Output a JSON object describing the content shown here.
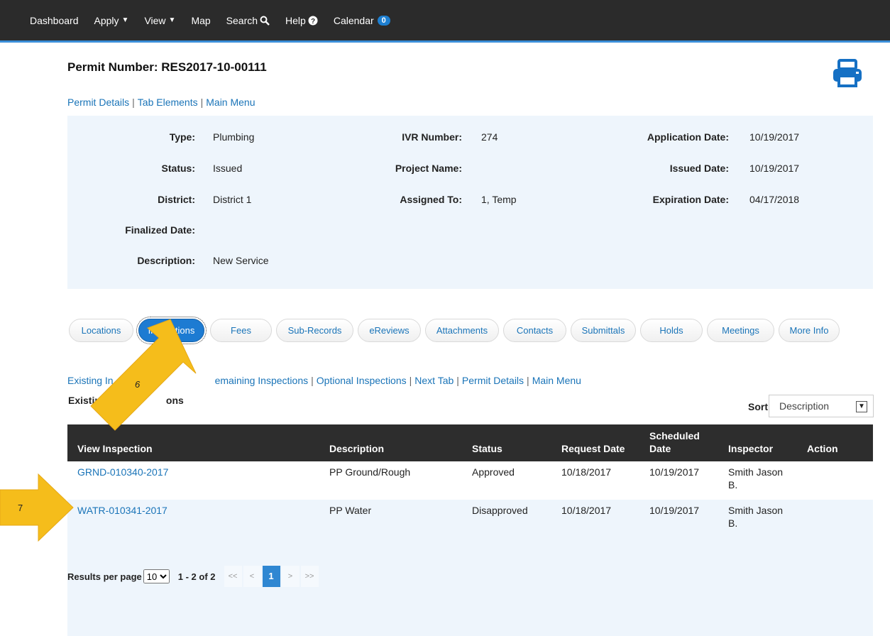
{
  "nav": {
    "dashboard": "Dashboard",
    "apply": "Apply",
    "view": "View",
    "map": "Map",
    "search": "Search",
    "help": "Help",
    "calendar": "Calendar",
    "calendar_count": "0"
  },
  "permit": {
    "title": "Permit Number: RES2017-10-00111"
  },
  "top_links": {
    "permit_details": "Permit Details",
    "tab_elements": "Tab Elements",
    "main_menu": "Main Menu",
    "sep": "|"
  },
  "details": {
    "type_label": "Type:",
    "type_value": "Plumbing",
    "status_label": "Status:",
    "status_value": "Issued",
    "district_label": "District:",
    "district_value": "District 1",
    "finalized_label": "Finalized Date:",
    "finalized_value": "",
    "description_label": "Description:",
    "description_value": "New Service",
    "ivr_label": "IVR Number:",
    "ivr_value": "274",
    "project_label": "Project Name:",
    "project_value": "",
    "assigned_label": "Assigned To:",
    "assigned_value": "1, Temp",
    "app_date_label": "Application Date:",
    "app_date_value": "10/19/2017",
    "issued_date_label": "Issued Date:",
    "issued_date_value": "10/19/2017",
    "exp_date_label": "Expiration Date:",
    "exp_date_value": "04/17/2018"
  },
  "tabs": [
    {
      "label": "Locations"
    },
    {
      "label": "Inspections"
    },
    {
      "label": "Fees"
    },
    {
      "label": "Sub-Records"
    },
    {
      "label": "eReviews"
    },
    {
      "label": "Attachments"
    },
    {
      "label": "Contacts"
    },
    {
      "label": "Submittals"
    },
    {
      "label": "Holds"
    },
    {
      "label": "Meetings"
    },
    {
      "label": "More Info"
    }
  ],
  "inspection_links": {
    "existing": "Existing In",
    "remaining": "emaining Inspections",
    "optional": "Optional Inspections",
    "next_tab": "Next Tab",
    "permit_details": "Permit Details",
    "main_menu": "Main Menu"
  },
  "section": {
    "subtitle_start": "Existin",
    "subtitle_end": "ons"
  },
  "sort": {
    "label": "Sort",
    "selected": "Description"
  },
  "table": {
    "headers": {
      "view": "View Inspection",
      "description": "Description",
      "status": "Status",
      "request": "Request Date",
      "scheduled_1": "Scheduled",
      "scheduled_2": "Date",
      "inspector": "Inspector",
      "action": "Action"
    },
    "rows": [
      {
        "id": "GRND-010340-2017",
        "description": "PP Ground/Rough",
        "status": "Approved",
        "request": "10/18/2017",
        "scheduled": "10/19/2017",
        "inspector_1": "Smith Jason",
        "inspector_2": "B."
      },
      {
        "id": "WATR-010341-2017",
        "description": "PP Water",
        "status": "Disapproved",
        "request": "10/18/2017",
        "scheduled": "10/19/2017",
        "inspector_1": "Smith Jason",
        "inspector_2": "B."
      }
    ]
  },
  "pager": {
    "label": "Results per page",
    "per_page": "10",
    "count": "1 - 2 of 2",
    "first": "<<",
    "prev": "<",
    "current": "1",
    "next": ">",
    "last": ">>"
  },
  "annotations": {
    "step6": "6",
    "step7": "7"
  },
  "colors": {
    "nav_bg": "#2b2b2b",
    "accent": "#1d7bd2",
    "panel_bg": "#eef5fc",
    "arrow": "#f5bd1b"
  }
}
